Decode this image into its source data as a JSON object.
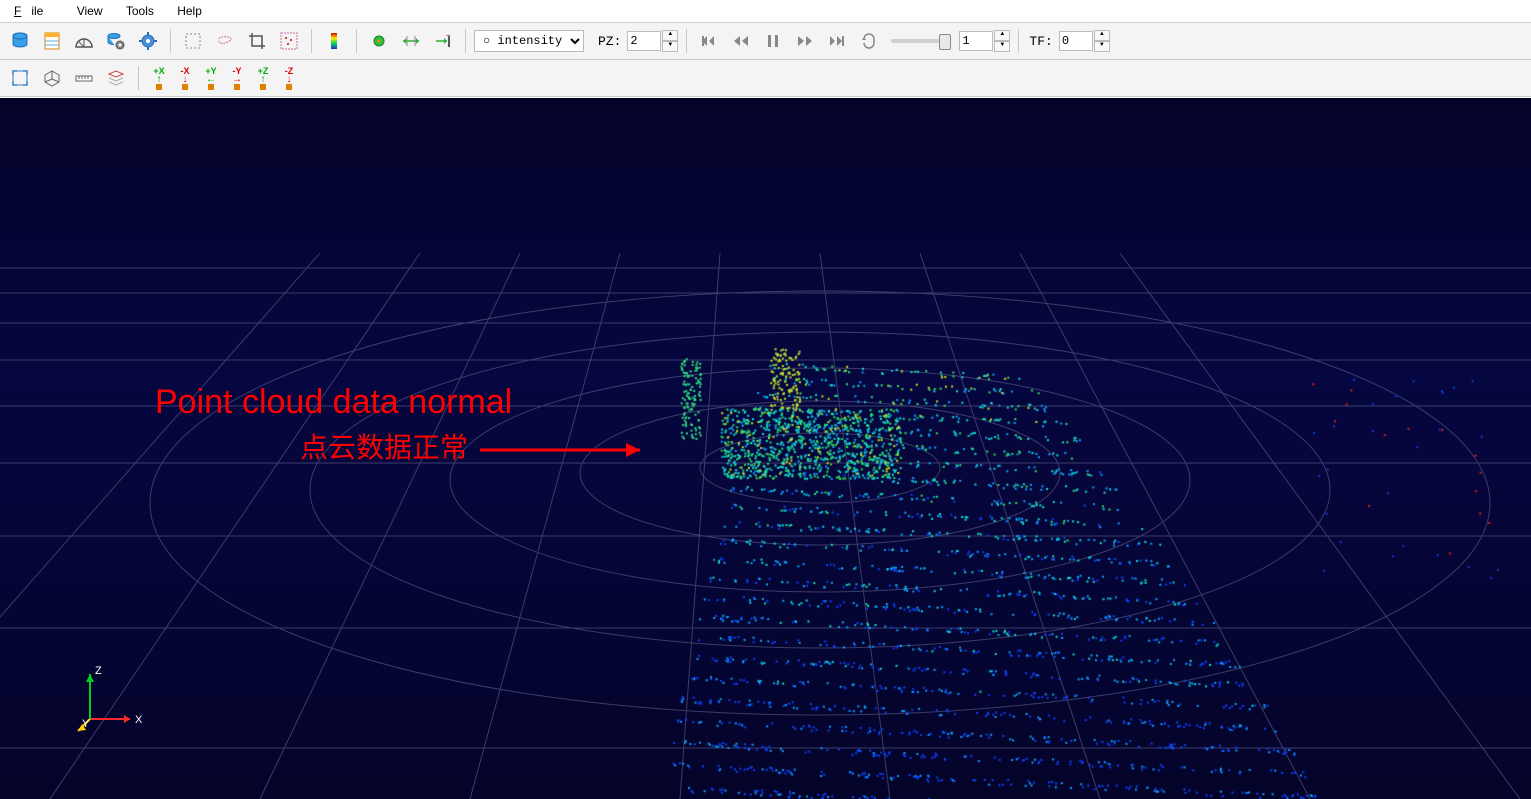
{
  "menu": {
    "file": "File",
    "view": "View",
    "tools": "Tools",
    "help": "Help"
  },
  "toolbar1": {
    "color_dropdown": {
      "value": "intensity",
      "prefix": "○ "
    },
    "pz": {
      "label": "PZ:",
      "value": "2"
    },
    "frame": {
      "value": "1"
    },
    "tf": {
      "label": "TF:",
      "value": "0"
    }
  },
  "toolbar2": {
    "axes": [
      "+X",
      "-X",
      "+Y",
      "-Y",
      "+Z",
      "-Z"
    ]
  },
  "annotations": {
    "en": "Point cloud data normal",
    "zh": "点云数据正常"
  },
  "axis_gizmo": {
    "x": "X",
    "y": "Y",
    "z": "Z"
  },
  "colors": {
    "accent_red": "#ff0000",
    "ax_x": "#ff2a2a",
    "ax_y": "#ffcc00",
    "ax_z": "#00d020",
    "grid": "#4a4a70"
  }
}
